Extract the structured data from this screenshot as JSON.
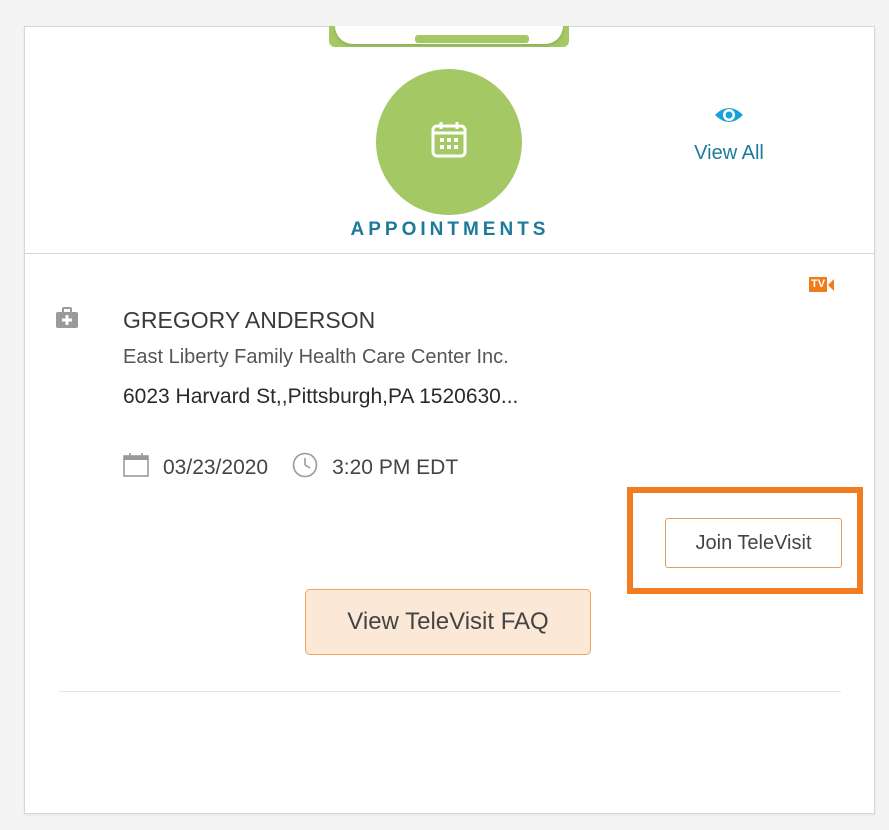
{
  "header": {
    "title": "APPOINTMENTS",
    "view_all_label": "View All",
    "icons": {
      "main": "calendar-icon",
      "view_all": "eye-icon"
    }
  },
  "appointment": {
    "badge": "TV",
    "doctor_name": "GREGORY ANDERSON",
    "facility": "East Liberty Family Health Care Center Inc.",
    "address": "6023 Harvard St,,Pittsburgh,PA 1520630...",
    "date": "03/23/2020",
    "time": "3:20 PM EDT",
    "join_label": "Join TeleVisit",
    "faq_label": "View TeleVisit FAQ"
  },
  "colors": {
    "accent_green": "#a3c864",
    "title_blue": "#1e7a9a",
    "highlight_orange": "#f47c20",
    "faq_bg": "#fce8d6"
  }
}
